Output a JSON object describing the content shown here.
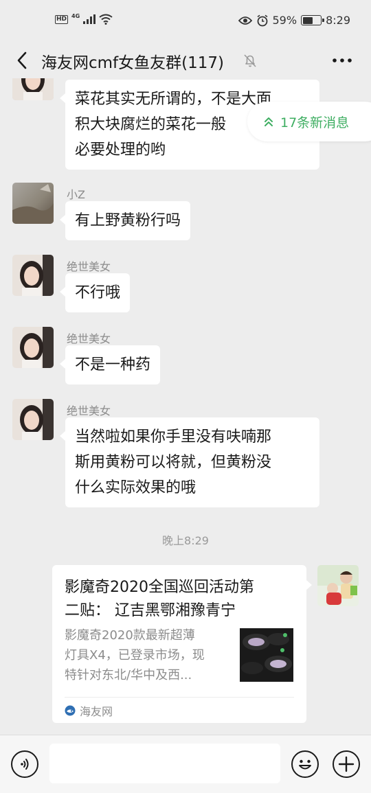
{
  "status_bar": {
    "hd": "HD",
    "network": "4G",
    "battery_percent": "59%",
    "battery_level": 0.59,
    "time": "8:29"
  },
  "header": {
    "title": "海友网cmf女鱼友群(117)",
    "back_icon": "chevron-left-icon",
    "mute_icon": "bell-muted-icon",
    "more_icon": "more-dots-icon"
  },
  "new_messages_badge": {
    "label": "17条新消息",
    "icon": "double-chevron-up-icon",
    "color": "#3fae62"
  },
  "messages": [
    {
      "sender": "",
      "lines": [
        "菜花其实无所谓的，不是大面",
        "积大块腐烂的菜花一般",
        "必要处理的哟"
      ]
    },
    {
      "sender": "小Z",
      "lines": [
        "有上野黄粉行吗"
      ]
    },
    {
      "sender": "绝世美女",
      "lines": [
        "不行哦"
      ]
    },
    {
      "sender": "绝世美女",
      "lines": [
        "不是一种药"
      ]
    },
    {
      "sender": "绝世美女",
      "lines": [
        "当然啦如果你手里没有呋喃那",
        "斯用黄粉可以将就，但黄粉没",
        "什么实际效果的哦"
      ]
    }
  ],
  "timestamp": "晚上8:29",
  "link_card": {
    "title_lines": [
      "影魔奇2020全国巡回活动第",
      "二贴： 辽吉黑鄂湘豫青宁"
    ],
    "desc_lines": [
      "影魔奇2020款最新超薄",
      "灯具X4，已登录市场，现",
      "特针对东北/华中及西..."
    ],
    "source": "海友网"
  },
  "input_bar": {
    "placeholder": "",
    "voice_icon": "voice-icon",
    "emoji_icon": "emoji-icon",
    "plus_icon": "plus-icon"
  }
}
